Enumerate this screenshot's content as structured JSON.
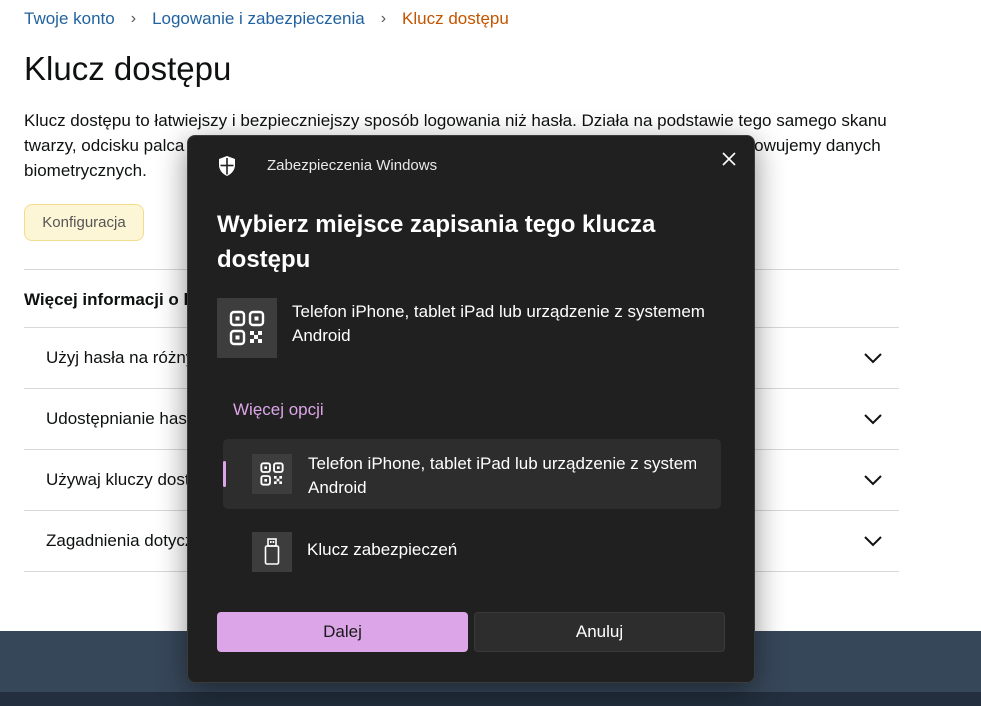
{
  "breadcrumb": {
    "items": [
      "Twoje konto",
      "Logowanie i zabezpieczenia",
      "Klucz dostępu"
    ],
    "separator": "›"
  },
  "page": {
    "title": "Klucz dostępu",
    "intro": "Klucz dostępu to łatwiejszy i bezpieczniejszy sposób logowania niż hasła. Działa na podstawie tego samego skanu twarzy, odcisku palca lub kodu PIN, którego używasz do odblokowywania urządzenia. Nie przechowujemy danych biometrycznych.",
    "config_button": "Konfiguracja"
  },
  "faq": {
    "heading": "Więcej informacji o kluczach dostępu",
    "items": [
      "Użyj hasła na różnych urządzeniach",
      "Udostępnianie haseł",
      "Używaj kluczy dostępu",
      "Zagadnienia dotyczące prywatności"
    ],
    "chevron_icon": "chevron-down-icon"
  },
  "dialog": {
    "app_name": "Zabezpieczenia Windows",
    "title": "Wybierz miejsce zapisania tego klucza dostępu",
    "primary_option": {
      "label": "Telefon iPhone, tablet iPad lub urządzenie z systemem Android",
      "icon": "qr-code-icon"
    },
    "more_options_label": "Więcej opcji",
    "options": [
      {
        "label_line1": "Telefon iPhone, tablet iPad lub urządzenie z systemem",
        "label_line2": "Android",
        "icon": "qr-code-icon",
        "selected": true
      },
      {
        "label": "Klucz zabezpieczeń",
        "icon": "usb-key-icon",
        "selected": false
      }
    ],
    "next_button": "Dalej",
    "cancel_button": "Anuluj",
    "accent_color": "#dca5e7"
  },
  "colors": {
    "link": "#2162a1",
    "current_crumb": "#c45500",
    "dialog_bg": "#202020",
    "footer": "#37475a"
  }
}
